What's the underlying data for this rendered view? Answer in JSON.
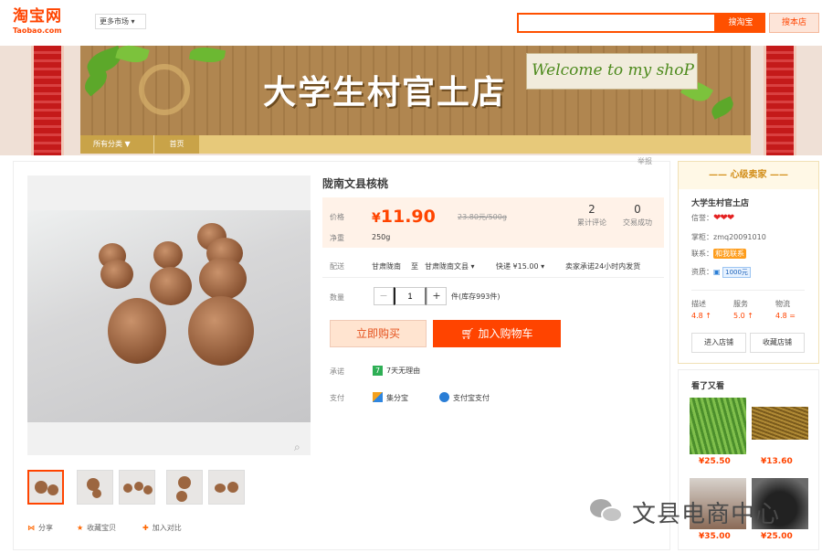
{
  "topbar": {
    "logo_cn": "淘宝网",
    "logo_en": "Taobao.com",
    "markets": "更多市场",
    "search_placeholder": "",
    "search_button": "搜淘宝",
    "store_button": "搜本店"
  },
  "banner": {
    "title": "大学生村官土店",
    "welcome": "Welcome to my shoP",
    "nav_all": "所有分类",
    "nav_home": "首页"
  },
  "report": "举报",
  "product": {
    "title": "陇南文县核桃",
    "price_label": "价格",
    "currency": "¥",
    "price": "11.90",
    "unit_price": "23.80元/500g",
    "weight_label": "净重",
    "weight": "250g",
    "reviews_count": "2",
    "reviews_label": "累计评论",
    "sales_count": "0",
    "sales_label": "交易成功",
    "delivery_label": "配送",
    "delivery_from": "甘肃陇南",
    "delivery_to_word": "至",
    "delivery_to": "甘肃陇南文县",
    "shipping": "快递 ¥15.00",
    "ship_promise": "卖家承诺24小时内发货",
    "qty_label": "数量",
    "qty_value": "1",
    "qty_minus": "−",
    "qty_plus": "+",
    "stock": "件(库存993件)",
    "buy_now": "立即购买",
    "add_cart": "加入购物车",
    "promise_label": "承诺",
    "promise_badge": "7",
    "promise_text": "7天无理由",
    "pay_label": "支付",
    "pay_option1": "集分宝",
    "pay_option2": "支付宝支付"
  },
  "gallery": {
    "zoom_icon": "search-icon",
    "thumb_count_shown": 5,
    "actions": [
      "分享",
      "收藏宝贝",
      "加入对比"
    ]
  },
  "seller": {
    "header": "心级卖家",
    "shop_name": "大学生村官土店",
    "credit_label": "信誉：",
    "credit_hearts": "❤❤❤",
    "owner_label": "掌柜：",
    "owner": "zmq20091010",
    "contact_label": "联系：",
    "contact": "和我联系",
    "qual_label": "资质：",
    "qual_value": "1000元",
    "dsr": [
      {
        "label": "描述",
        "value": "4.8 ↑"
      },
      {
        "label": "服务",
        "value": "5.0 ↑"
      },
      {
        "label": "物流",
        "value": "4.8 ="
      }
    ],
    "enter_shop": "进入店铺",
    "fav_shop": "收藏店铺"
  },
  "also_viewed": {
    "title": "看了又看",
    "items": [
      {
        "price": "¥25.50"
      },
      {
        "price": "¥13.60"
      },
      {
        "price": "¥35.00"
      },
      {
        "price": "¥25.00"
      }
    ]
  },
  "watermark": "文县电商中心",
  "colors": {
    "accent": "#ff4400",
    "price": "#ff4400",
    "banner_wood": "#b08650"
  }
}
